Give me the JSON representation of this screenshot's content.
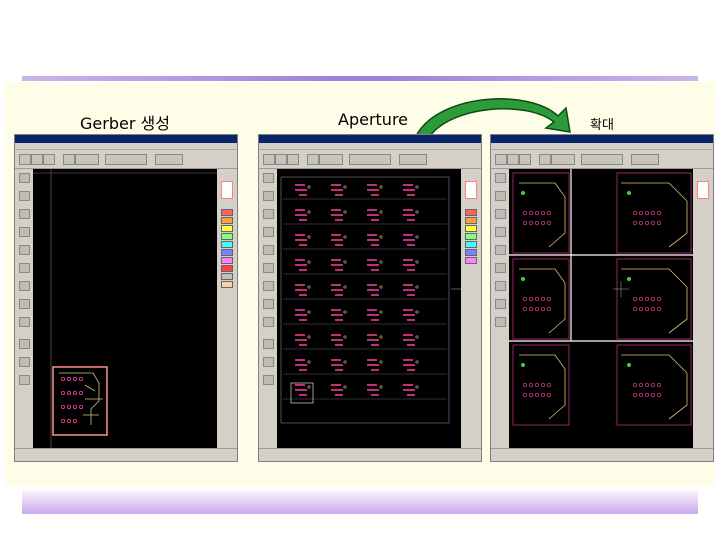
{
  "captions": {
    "gerber": "Gerber 생성",
    "aperture": "Aperture",
    "zoom": "확대"
  },
  "colors": {
    "accent_rule": "#9a7fd6",
    "panel_bg": "#fefee8",
    "arrow_green": "#2e9b3a",
    "pcb_trace": "#d9c070",
    "pcb_pad": "#ff40a0",
    "pcb_outline": "#ff8080"
  },
  "icons": {
    "flow_arrow": "curved-arrow-icon"
  },
  "screenshots": [
    {
      "name": "gerber-generation-window"
    },
    {
      "name": "aperture-window"
    },
    {
      "name": "zoom-window"
    }
  ]
}
